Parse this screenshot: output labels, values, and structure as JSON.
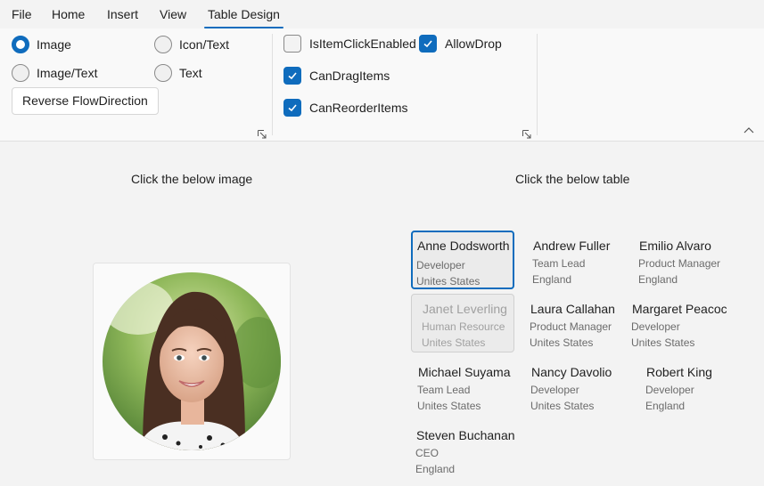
{
  "menu": {
    "tabs": [
      {
        "label": "File"
      },
      {
        "label": "Home"
      },
      {
        "label": "Insert"
      },
      {
        "label": "View"
      },
      {
        "label": "Table Design",
        "active": true
      }
    ]
  },
  "ribbon": {
    "display_mode": {
      "options": [
        {
          "label": "Image",
          "checked": true
        },
        {
          "label": "Icon/Text",
          "checked": false
        },
        {
          "label": "Image/Text",
          "checked": false
        },
        {
          "label": "Text",
          "checked": false
        }
      ],
      "reverse_button": "Reverse FlowDirection"
    },
    "options": [
      {
        "label": "IsItemClickEnabled",
        "checked": false
      },
      {
        "label": "AllowDrop",
        "checked": true
      },
      {
        "label": "CanDragItems",
        "checked": true
      },
      {
        "label": "CanReorderItems",
        "checked": true
      }
    ]
  },
  "content": {
    "image_hint": "Click the below image",
    "table_hint": "Click the below table",
    "people": [
      {
        "name": "Anne Dodsworth",
        "role": "Developer",
        "country": "Unites States",
        "state": "selected"
      },
      {
        "name": "Andrew Fuller",
        "role": "Team Lead",
        "country": "England"
      },
      {
        "name": "Emilio Alvaro",
        "role": "Product Manager",
        "country": "England"
      },
      {
        "name": "Janet Leverling",
        "role": "Human Resource",
        "country": "Unites States",
        "state": "pressed"
      },
      {
        "name": "Laura Callahan",
        "role": "Product Manager",
        "country": "Unites States"
      },
      {
        "name": "Margaret Peacock",
        "role": "Developer",
        "country": "Unites States"
      },
      {
        "name": "Michael Suyama",
        "role": "Team Lead",
        "country": "Unites States"
      },
      {
        "name": "Nancy Davolio",
        "role": "Developer",
        "country": "Unites States"
      },
      {
        "name": "Robert King",
        "role": "Developer",
        "country": "England"
      },
      {
        "name": "Steven Buchanan",
        "role": "CEO",
        "country": "England"
      }
    ]
  },
  "colors": {
    "accent": "#0f6cbd"
  }
}
